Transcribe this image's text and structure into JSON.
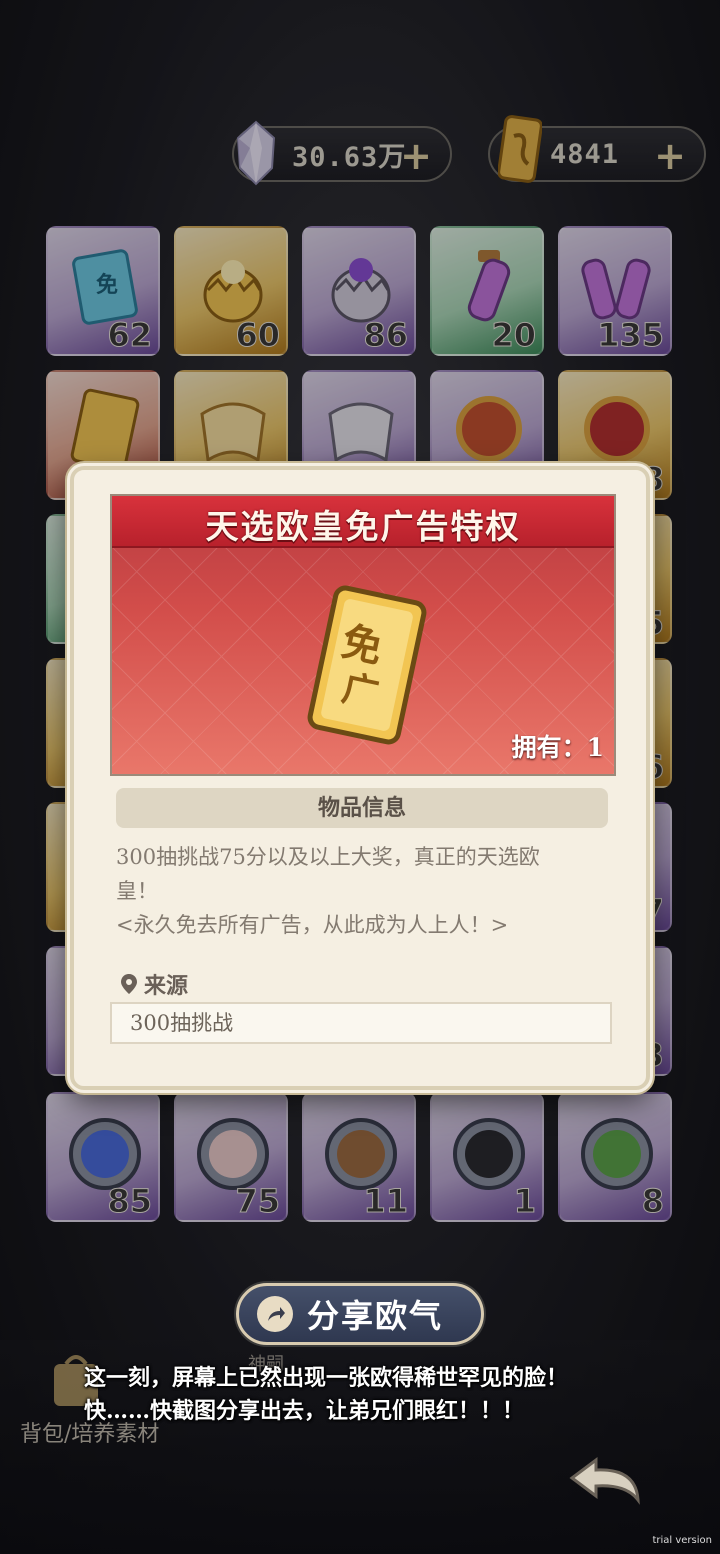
{
  "currency": {
    "crystal_value": "30.63万",
    "ticket_value": "4841",
    "plus": "+"
  },
  "grid": {
    "row1": [
      {
        "name": "free-ticket-small",
        "count": "62",
        "rarity": "purple"
      },
      {
        "name": "golden-egg",
        "count": "60",
        "rarity": "gold"
      },
      {
        "name": "purple-egg",
        "count": "86",
        "rarity": "purple"
      },
      {
        "name": "potion",
        "count": "20",
        "rarity": "green"
      },
      {
        "name": "double-potion",
        "count": "135",
        "rarity": "purple"
      }
    ],
    "row7": [
      {
        "name": "character-medal-1",
        "count": "85"
      },
      {
        "name": "character-medal-2",
        "count": "75"
      },
      {
        "name": "character-medal-3",
        "count": "11"
      },
      {
        "name": "character-medal-4",
        "count": "1"
      },
      {
        "name": "character-medal-5",
        "count": "8"
      }
    ],
    "partial_counts": [
      "8",
      "5",
      "6",
      "7",
      "3"
    ]
  },
  "modal": {
    "title": "天选欧皇免广告特权",
    "owned_label": "拥有：1",
    "section_title": "物品信息",
    "description_line1": "300抽挑战75分以及以上大奖，真正的天选欧",
    "description_line2": "皇！",
    "description_line3": "<永久免去所有广告，从此成为人上人！>",
    "source_label": "来源",
    "source_value": "300抽挑战"
  },
  "share_button": {
    "label": "分享欧气"
  },
  "bottom": {
    "tab_label": "背包/培养素材",
    "tab_label_2": "神嗣"
  },
  "caption": {
    "line1": "这一刻，屏幕上已然出现一张欧得稀世罕见的脸！",
    "line2": "快……快截图分享出去，让弟兄们眼红！！！"
  },
  "watermark": "trial version"
}
